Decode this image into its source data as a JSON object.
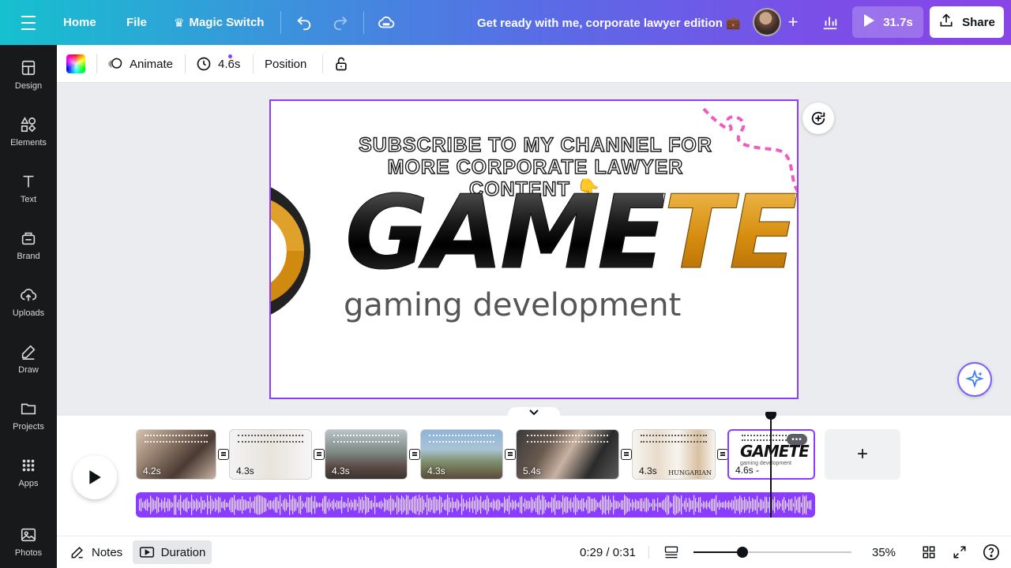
{
  "header": {
    "home_label": "Home",
    "file_label": "File",
    "magic_switch_label": "Magic Switch",
    "doc_title": "Get ready with me, corporate lawyer edition 💼",
    "play_duration": "31.7s",
    "share_label": "Share"
  },
  "sidebar": {
    "items": [
      {
        "label": "Design",
        "icon": "design-icon"
      },
      {
        "label": "Elements",
        "icon": "elements-icon"
      },
      {
        "label": "Text",
        "icon": "text-icon"
      },
      {
        "label": "Brand",
        "icon": "brand-icon"
      },
      {
        "label": "Uploads",
        "icon": "uploads-icon"
      },
      {
        "label": "Draw",
        "icon": "draw-icon"
      },
      {
        "label": "Projects",
        "icon": "projects-icon"
      },
      {
        "label": "Apps",
        "icon": "apps-icon"
      },
      {
        "label": "Photos",
        "icon": "photos-icon"
      }
    ]
  },
  "toolbar": {
    "animate_label": "Animate",
    "timing_label": "4.6s",
    "position_label": "Position"
  },
  "canvas": {
    "subscribe_text": "SUBSCRIBE TO MY CHANNEL FOR MORE CORPORATE LAWYER CONTENT 👇",
    "logo_part1": "GAME",
    "logo_part2": "TE",
    "tagline": "gaming development"
  },
  "timeline": {
    "clips": [
      {
        "duration": "4.2s",
        "theme": "photo-family"
      },
      {
        "duration": "4.3s",
        "theme": "meme-comic"
      },
      {
        "duration": "4.3s",
        "theme": "photo-outdoor"
      },
      {
        "duration": "4.3s",
        "theme": "photo-beach"
      },
      {
        "duration": "5.4s",
        "theme": "photo-group"
      },
      {
        "duration": "4.3s",
        "theme": "meme-hungarian"
      },
      {
        "duration": "4.6s -",
        "theme": "logo-gamete"
      }
    ],
    "clip6_caption": "HUNGARIAN",
    "clip7_logo": "GAMETE",
    "clip7_tagline": "gaming development"
  },
  "footer": {
    "notes_label": "Notes",
    "duration_label": "Duration",
    "time_display": "0:29 / 0:31",
    "zoom_label": "35%",
    "zoom_fraction": 0.35
  },
  "colors": {
    "accent": "#8b3dff",
    "sidebar_bg": "#18191b"
  }
}
